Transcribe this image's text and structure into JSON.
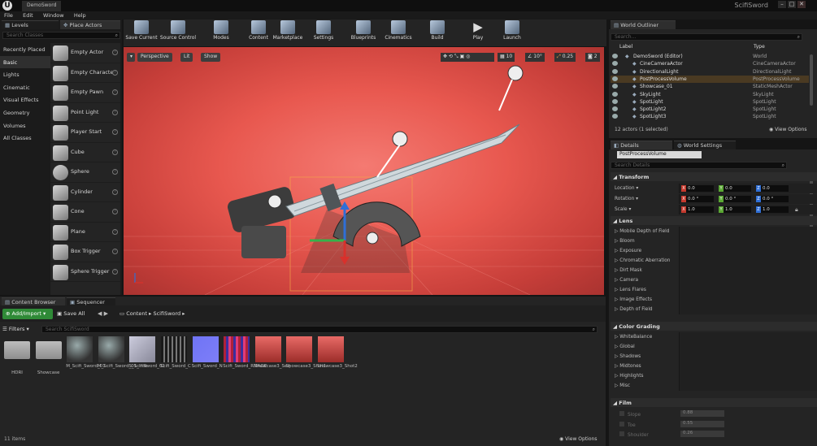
{
  "window": {
    "doc_tab": "DemoSword",
    "project": "ScifiSword"
  },
  "menu": [
    "File",
    "Edit",
    "Window",
    "Help"
  ],
  "place_mode": {
    "tabs": {
      "levels": "Levels",
      "place_actors": "Place Actors"
    },
    "search_placeholder": "Search Classes",
    "categories": [
      "Recently Placed",
      "Basic",
      "Lights",
      "Cinematic",
      "Visual Effects",
      "Geometry",
      "Volumes",
      "All Classes"
    ],
    "selected_category": "Basic",
    "actors": [
      "Empty Actor",
      "Empty Characte",
      "Empty Pawn",
      "Point Light",
      "Player Start",
      "Cube",
      "Sphere",
      "Cylinder",
      "Cone",
      "Plane",
      "Box Trigger",
      "Sphere Trigger"
    ]
  },
  "toolbar": [
    "Save Current",
    "Source Control",
    "Modes",
    "Content",
    "Marketplace",
    "Settings",
    "Blueprints",
    "Cinematics",
    "Build",
    "Play",
    "Launch"
  ],
  "viewport": {
    "perspective": "Perspective",
    "lit": "Lit",
    "show": "Show",
    "grid_snap": "10",
    "rot_snap": "10°",
    "scale_snap": "0.25",
    "camera_speed": "2"
  },
  "content_browser": {
    "tabs": {
      "content_browser": "Content Browser",
      "sequencer": "Sequencer"
    },
    "add_import": "Add/Import",
    "save_all": "Save All",
    "path": [
      "Content",
      "ScifiSword"
    ],
    "filters": "Filters",
    "search_placeholder": "Search ScifiSword",
    "assets": [
      {
        "name": "HDRI",
        "kind": "folder"
      },
      {
        "name": "Showcase",
        "kind": "folder"
      },
      {
        "name": "M_Scifi_Sword_01",
        "kind": "material"
      },
      {
        "name": "M_Scifi_Sword_01_Inst",
        "kind": "material"
      },
      {
        "name": "S_ScifiSword_01",
        "kind": "mesh"
      },
      {
        "name": "Scifi_Sword_C",
        "kind": "texture-color"
      },
      {
        "name": "Scifi_Sword_N",
        "kind": "texture-normal"
      },
      {
        "name": "Scifi_Sword_RMAOE",
        "kind": "texture-mask"
      },
      {
        "name": "Showcase3_Seq",
        "kind": "sequence"
      },
      {
        "name": "Showcase3_Shot1",
        "kind": "sequence"
      },
      {
        "name": "Showcase3_Shot2",
        "kind": "sequence"
      }
    ],
    "item_count": "11 items",
    "view_options": "View Options"
  },
  "world_outliner": {
    "tab": "World Outliner",
    "search_placeholder": "Search...",
    "col_label": "Label",
    "col_type": "Type",
    "rows": [
      {
        "label": "DemoSword (Editor)",
        "type": "World",
        "selected": false
      },
      {
        "label": "CineCameraActor",
        "type": "CineCameraActor",
        "selected": false
      },
      {
        "label": "DirectionalLight",
        "type": "DirectionalLight",
        "selected": false
      },
      {
        "label": "PostProcessVolume",
        "type": "PostProcessVolume",
        "selected": true
      },
      {
        "label": "Showcase_01",
        "type": "StaticMeshActor",
        "selected": false
      },
      {
        "label": "SkyLight",
        "type": "SkyLight",
        "selected": false
      },
      {
        "label": "SpotLight",
        "type": "SpotLight",
        "selected": false
      },
      {
        "label": "SpotLight2",
        "type": "SpotLight",
        "selected": false
      },
      {
        "label": "SpotLight3",
        "type": "SpotLight",
        "selected": false
      }
    ],
    "actor_count": "12 actors (1 selected)",
    "view_options": "View Options"
  },
  "details": {
    "tabs": {
      "details": "Details",
      "world_settings": "World Settings"
    },
    "selected_name": "PostProcessVolume",
    "search_placeholder": "Search Details",
    "transform": {
      "header": "Transform",
      "location": {
        "label": "Location",
        "x": "0.0",
        "y": "0.0",
        "z": "0.0"
      },
      "rotation": {
        "label": "Rotation",
        "x": "0.0 °",
        "y": "0.0 °",
        "z": "0.0 °"
      },
      "scale": {
        "label": "Scale",
        "x": "1.0",
        "y": "1.0",
        "z": "1.0"
      }
    },
    "lens": {
      "header": "Lens",
      "items": [
        "Mobile Depth of Field",
        "Bloom",
        "Exposure",
        "Chromatic Aberration",
        "Dirt Mask",
        "Camera",
        "Lens Flares",
        "Image Effects",
        "Depth of Field"
      ]
    },
    "color_grading": {
      "header": "Color Grading",
      "items": [
        "WhiteBalance",
        "Global",
        "Shadows",
        "Midtones",
        "Highlights",
        "Misc"
      ]
    },
    "film": {
      "header": "Film",
      "items": [
        {
          "label": "Slope",
          "value": "0.88"
        },
        {
          "label": "Toe",
          "value": "0.55"
        },
        {
          "label": "Shoulder",
          "value": "0.26"
        }
      ]
    }
  },
  "colors": {
    "accent_green": "#2f8a37",
    "selection": "#4a3a22",
    "viewport_red": "#e8584f"
  }
}
